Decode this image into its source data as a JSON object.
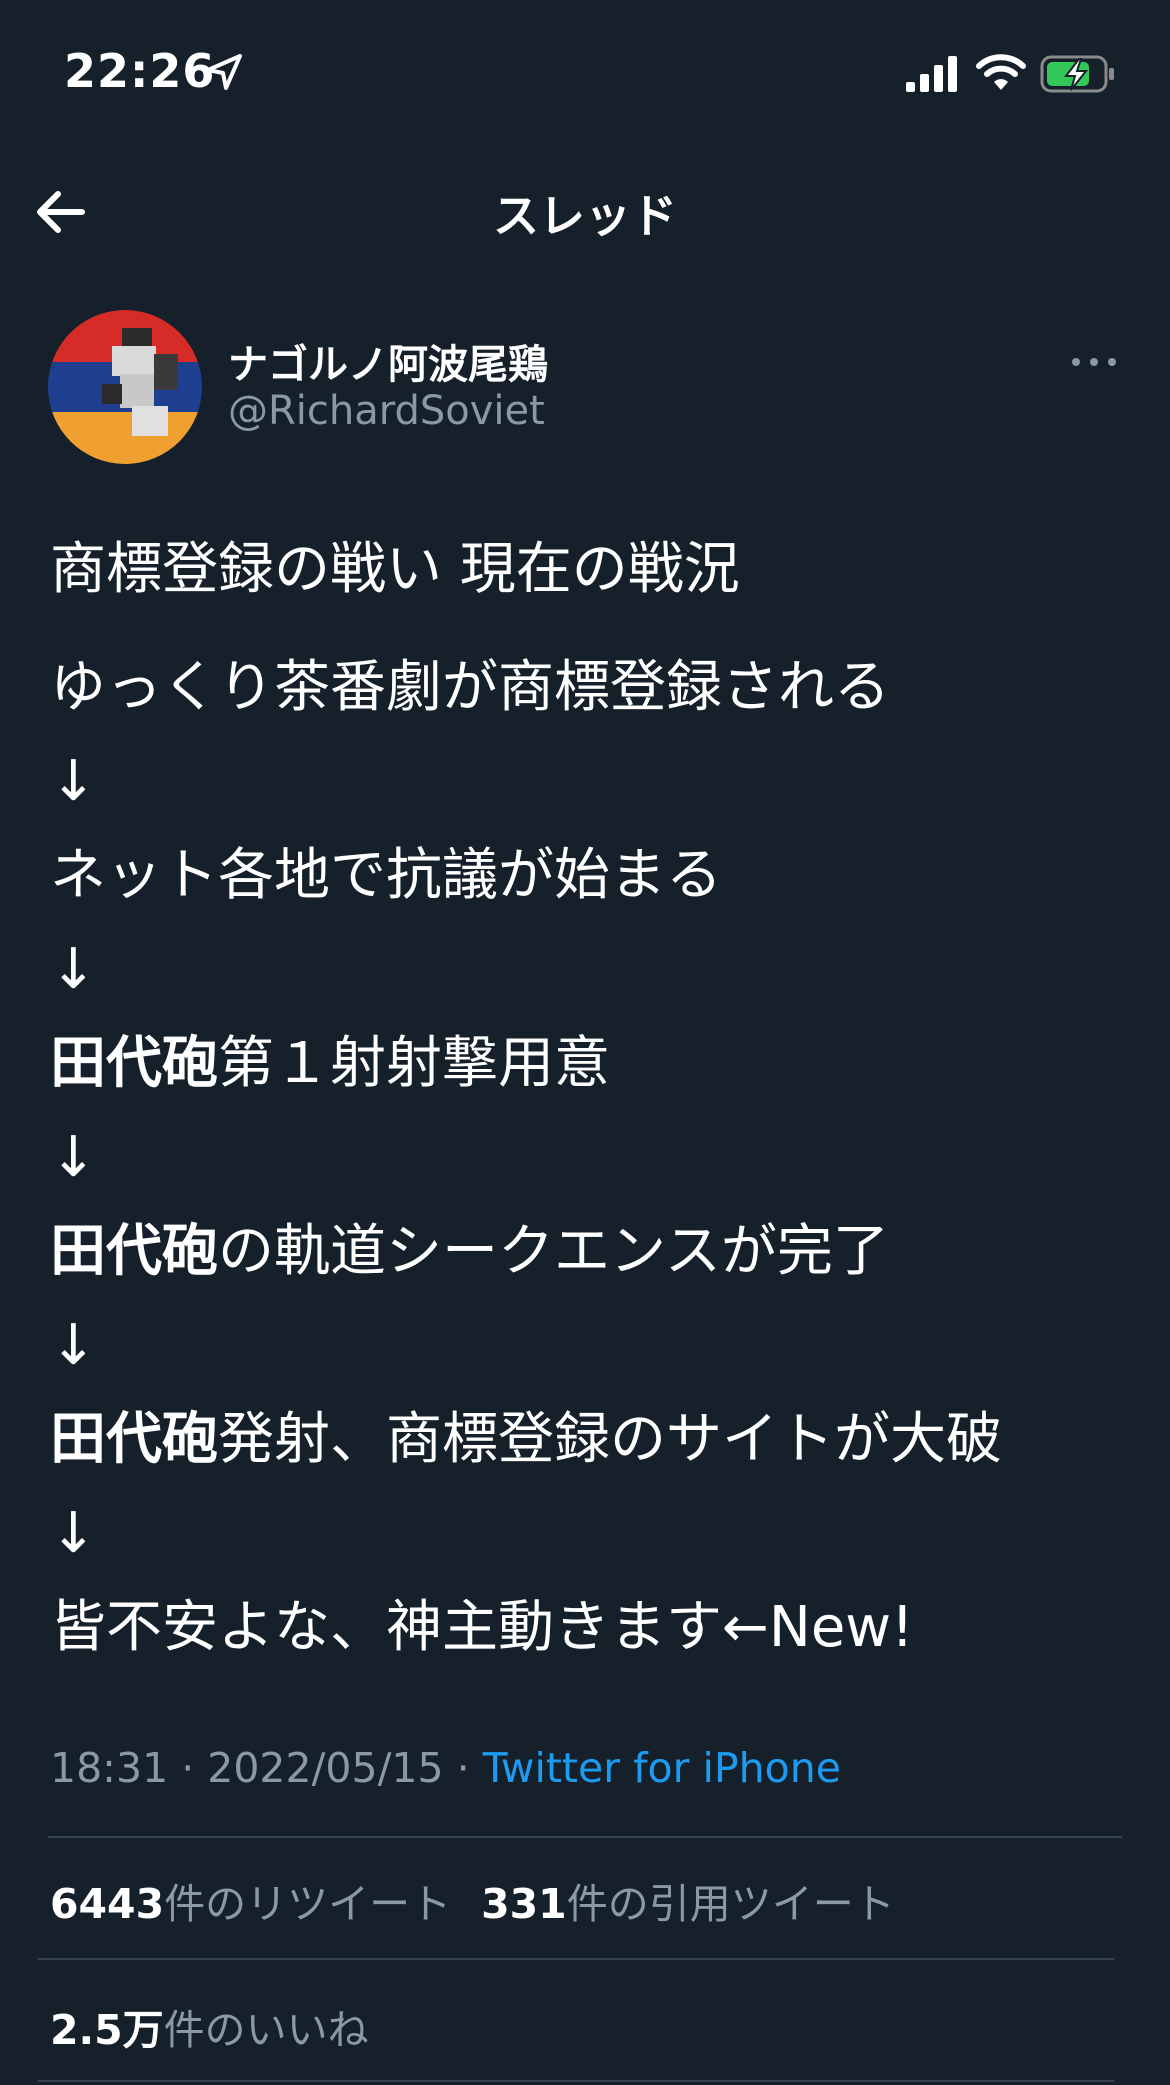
{
  "status_bar": {
    "time": "22:26",
    "icons": [
      "location-arrow-icon",
      "signal-icon",
      "wifi-icon",
      "battery-charging-icon"
    ]
  },
  "nav": {
    "title": "スレッド",
    "back_icon": "arrow-left-icon"
  },
  "author": {
    "display_name": "ナゴルノ阿波尾鶏",
    "handle": "@RichardSoviet"
  },
  "tweet": {
    "title": "商標登録の戦い 現在の戦況",
    "lines": [
      {
        "bold": "",
        "text": "ゆっくり茶番劇が商標登録される"
      },
      {
        "bold": "",
        "text": "↓"
      },
      {
        "bold": "",
        "text": "ネット各地で抗議が始まる"
      },
      {
        "bold": "",
        "text": "↓"
      },
      {
        "bold": "田代砲",
        "text": "第１射射撃用意"
      },
      {
        "bold": "",
        "text": "↓"
      },
      {
        "bold": "田代砲",
        "text": "の軌道シークエンスが完了"
      },
      {
        "bold": "",
        "text": "↓"
      },
      {
        "bold": "田代砲",
        "text": "発射、商標登録のサイトが大破"
      },
      {
        "bold": "",
        "text": "↓"
      },
      {
        "bold": "",
        "text": "皆不安よな、神主動きます←New!"
      }
    ]
  },
  "meta": {
    "timestamp": "18:31 · 2022/05/15 · ",
    "source": "Twitter for iPhone"
  },
  "stats": {
    "retweets_count": "6443",
    "retweets_label": "件のリツイート",
    "quotes_count": "331",
    "quotes_label": "件の引用ツイート",
    "likes_count": "2.5万",
    "likes_label": "件のいいね"
  },
  "colors": {
    "background": "#15202b",
    "link": "#1d9bf0",
    "secondary_text": "#8b98a5",
    "divider": "#38444d"
  }
}
